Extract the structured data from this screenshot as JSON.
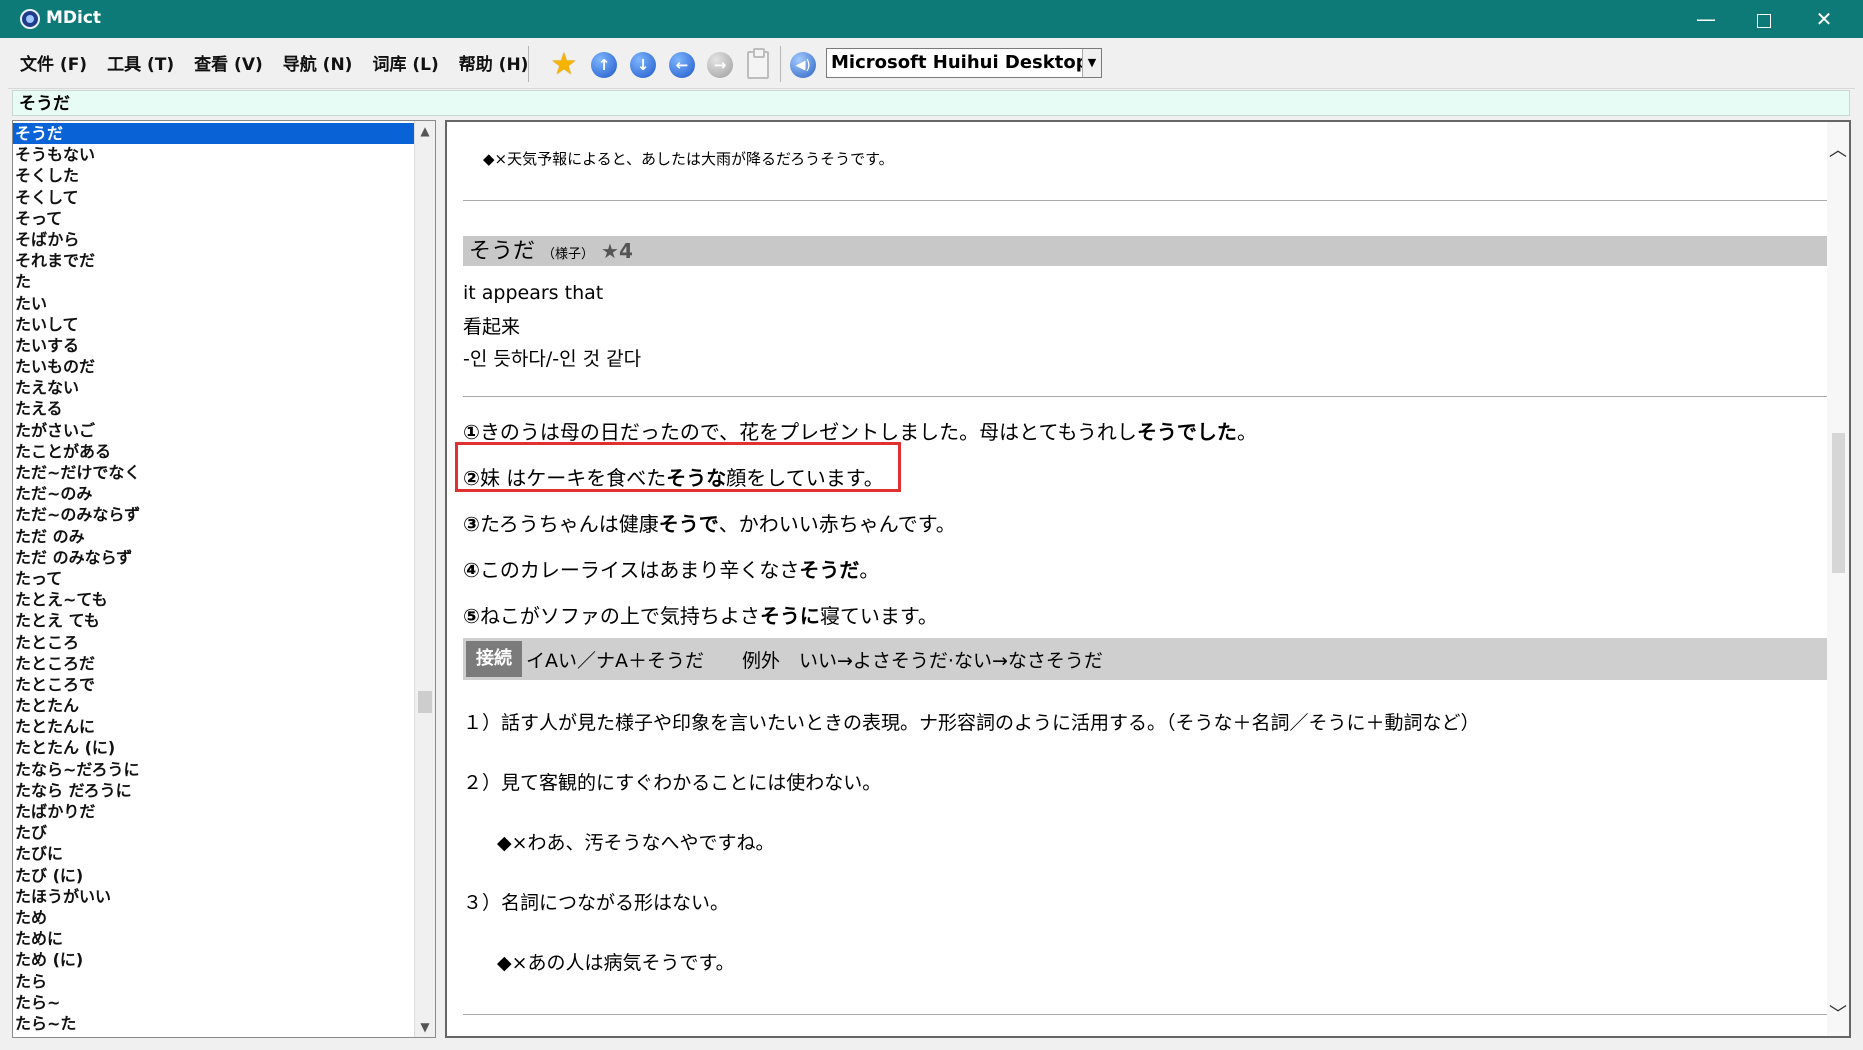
{
  "window": {
    "title": "MDict",
    "minimize": "—",
    "close": "✕"
  },
  "menu": [
    "文件 (F)",
    "工具 (T)",
    "查看 (V)",
    "导航 (N)",
    "词库 (L)",
    "帮助 (H)"
  ],
  "toolbar": {
    "icons": [
      "star-icon",
      "up-arrow-icon",
      "down-arrow-icon",
      "back-arrow-icon",
      "forward-arrow-icon",
      "clipboard-icon",
      "speaker-icon"
    ],
    "dictionary_selected": "Microsoft Huihui Desktop - C"
  },
  "search": {
    "value": "そうだ"
  },
  "wordlist": [
    "そうだ",
    "そうもない",
    "そくした",
    "そくして",
    "そって",
    "そばから",
    "それまでだ",
    "た",
    "たい",
    "たいして",
    "たいする",
    "たいものだ",
    "たえない",
    "たえる",
    "たがさいご",
    "たことがある",
    "ただ~だけでなく",
    "ただ~のみ",
    "ただ~のみならず",
    "ただ のみ",
    "ただ のみならず",
    "たって",
    "たとえ~ても",
    "たとえ ても",
    "たところ",
    "たところだ",
    "たところで",
    "たとたん",
    "たとたんに",
    "たとたん (に)",
    "たなら~だろうに",
    "たなら だろうに",
    "たばかりだ",
    "たび",
    "たびに",
    "たび (に)",
    "たほうがいい",
    "ため",
    "ために",
    "ため (に)",
    "たら",
    "たら~",
    "たら~た"
  ],
  "entry": {
    "top_note": "◆×天気予報によると、あしたは大雨が降るだろうそうです。",
    "headword": "そうだ",
    "headword_note": "（様子）",
    "stars": "★4",
    "gloss_en": "it appears that",
    "gloss_zh": "看起来",
    "gloss_ko": "-인 듯하다/-인 것 같다",
    "examples": [
      {
        "num": "①",
        "pre": "きのうは母の日だったので、花をプレゼントしました。母はとてもうれし",
        "bold": "そうでした",
        "post": "。"
      },
      {
        "num": "②",
        "pre": "妹 はケーキを食べた",
        "bold": "そうな",
        "post": "顔をしています。"
      },
      {
        "num": "③",
        "pre": "たろうちゃんは健康",
        "bold": "そうで",
        "post": "、かわいい赤ちゃんです。"
      },
      {
        "num": "④",
        "pre": "このカレーライスはあまり辛くなさ",
        "bold": "そうだ",
        "post": "。"
      },
      {
        "num": "⑤",
        "pre": "ねこがソファの上で気持ちよさ",
        "bold": "そうに",
        "post": "寝ています。"
      }
    ],
    "connection_tag": "接続",
    "connection_text": "イAい／ナA＋そうだ　　例外　いい→よさそうだ·ない→なさそうだ",
    "notes": [
      "１）話す人が見た様子や印象を言いたいときの表現。ナ形容詞のように活用する。（そうな＋名詞／そうに＋動詞など）",
      "２）見て客観的にすぐわかることには使わない。",
      "◆×わあ、汚そうなへやですね。",
      "３）名詞につながる形はない。",
      "◆×あの人は病気そうです。"
    ]
  }
}
